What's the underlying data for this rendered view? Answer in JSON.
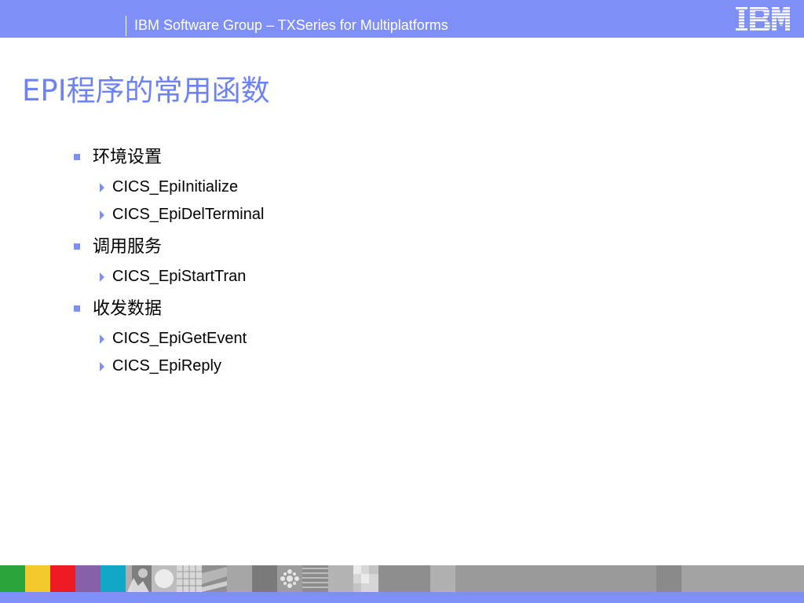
{
  "header": {
    "title": "IBM Software Group – TXSeries for Multiplatforms",
    "logo_text": "IBM"
  },
  "slide": {
    "title": "EPI程序的常用函数",
    "sections": [
      {
        "label": "环境设置",
        "items": [
          "CICS_EpiInitialize",
          "CICS_EpiDelTerminal"
        ]
      },
      {
        "label": "调用服务",
        "items": [
          "CICS_EpiStartTran"
        ]
      },
      {
        "label": "收发数据",
        "items": [
          "CICS_EpiGetEvent",
          "CICS_EpiReply"
        ]
      }
    ]
  },
  "colors": {
    "header_bg": "#7f8ff8",
    "title": "#6d82f3",
    "bullet": "#7f8ff8",
    "footer_strip": "#7f8ff8"
  },
  "footer": {
    "tile_colors": [
      "#2aa43a",
      "#f0c92c",
      "#ee1b24",
      "#8460a8",
      "#12a7c7"
    ]
  }
}
